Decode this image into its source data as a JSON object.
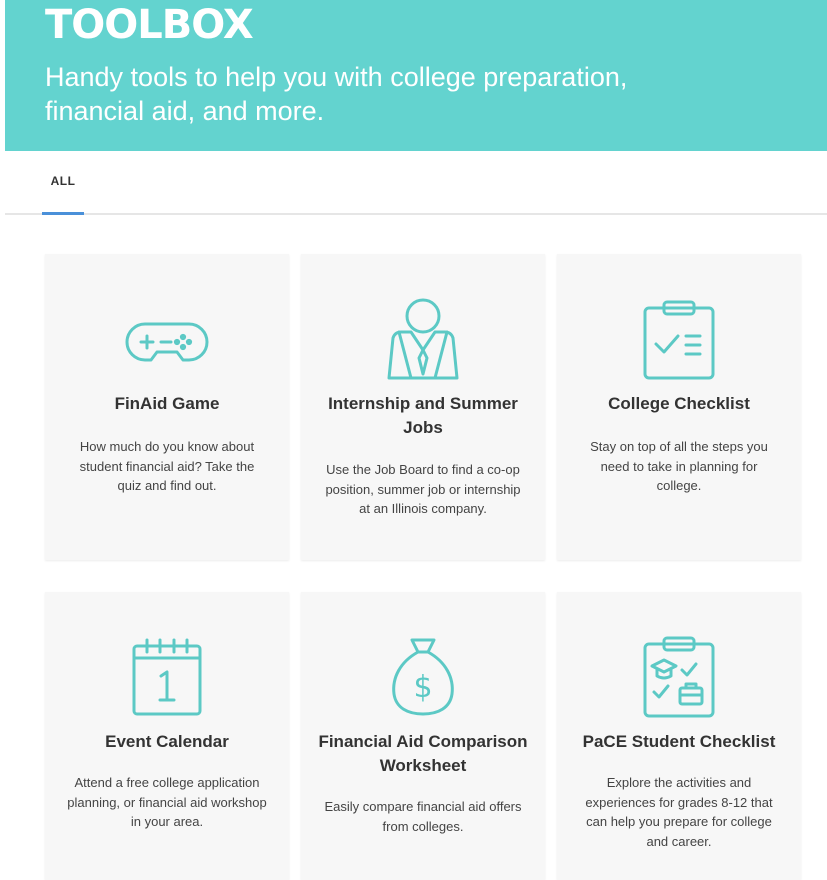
{
  "header": {
    "title": "TOOLBOX",
    "subtitle": "Handy tools to help you with college preparation, financial aid, and more."
  },
  "tabs": [
    {
      "label": "ALL",
      "active": true
    }
  ],
  "colors": {
    "hero_bg": "#63d3cf",
    "icon_stroke": "#5cc9c5",
    "tab_underline": "#4a90d9",
    "card_bg": "#f7f7f7"
  },
  "cards": [
    {
      "icon": "gamepad-icon",
      "title": "FinAid Game",
      "description": "How much do you know about student financial aid? Take the quiz and find out."
    },
    {
      "icon": "job-person-icon",
      "title": "Internship and Summer Jobs",
      "description": "Use the Job Board to find a co-op position, summer job or internship at an Illinois company."
    },
    {
      "icon": "clipboard-checklist-icon",
      "title": "College Checklist",
      "description": "Stay on top of all the steps you need to take in planning for college."
    },
    {
      "icon": "calendar-icon",
      "title": "Event Calendar",
      "description": "Attend a free college application planning, or financial aid workshop in your area."
    },
    {
      "icon": "money-bag-icon",
      "title": "Financial Aid Comparison Worksheet",
      "description": "Easily compare financial aid offers from colleges."
    },
    {
      "icon": "clipboard-grad-cap-icon",
      "title": "PaCE Student Checklist",
      "description": "Explore the activities and experiences for grades 8-12 that can help you prepare for college and career."
    }
  ]
}
